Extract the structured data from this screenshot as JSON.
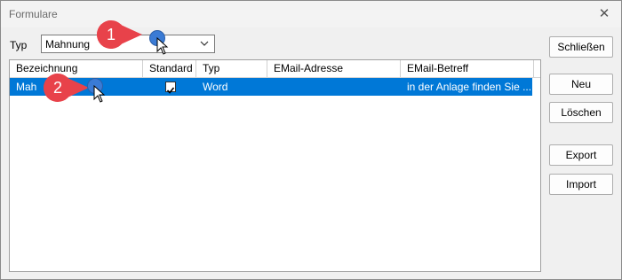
{
  "window": {
    "title": "Formulare"
  },
  "filter": {
    "label": "Typ",
    "selected": "Mahnung"
  },
  "grid": {
    "columns": [
      "Bezeichnung",
      "Standard",
      "Typ",
      "EMail-Adresse",
      "EMail-Betreff"
    ],
    "rows": [
      {
        "bezeichnung": "Mah",
        "standard": true,
        "typ": "Word",
        "email_adresse": "",
        "email_betreff": "in der Anlage finden Sie ..."
      }
    ]
  },
  "buttons": {
    "close": "Schließen",
    "new": "Neu",
    "delete": "Löschen",
    "export": "Export",
    "import": "Import"
  },
  "callouts": [
    "1",
    "2"
  ],
  "colors": {
    "selection": "#0078d7",
    "callout": "#e8424a",
    "dot": "#3a7bd5"
  }
}
